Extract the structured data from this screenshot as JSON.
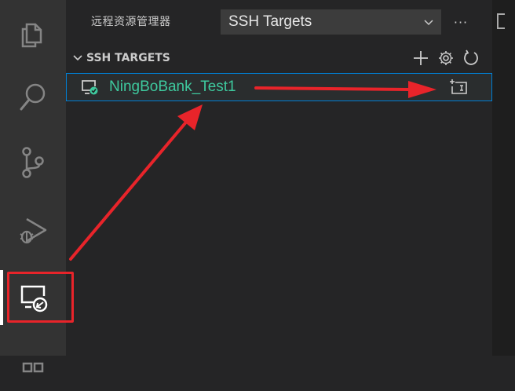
{
  "activity_bar": {
    "items": [
      {
        "icon": "files-icon"
      },
      {
        "icon": "search-icon"
      },
      {
        "icon": "source-control-icon"
      },
      {
        "icon": "run-debug-icon"
      },
      {
        "icon": "remote-explorer-icon",
        "active": true
      },
      {
        "icon": "extensions-icon"
      }
    ]
  },
  "sidebar": {
    "title": "远程资源管理器",
    "target_select": {
      "value": "SSH Targets"
    },
    "more_actions": "···",
    "section": {
      "label": "SSH TARGETS",
      "actions": [
        "add-icon",
        "gear-icon",
        "refresh-icon"
      ]
    },
    "hosts": [
      {
        "label": "NingBoBank_Test1",
        "status_color": "#3ec99e",
        "action": "open-new-window-icon"
      }
    ]
  },
  "annotation": {
    "color": "#e8242a"
  },
  "colors": {
    "accent_border": "#007fd4",
    "host_text": "#3ec99e"
  }
}
